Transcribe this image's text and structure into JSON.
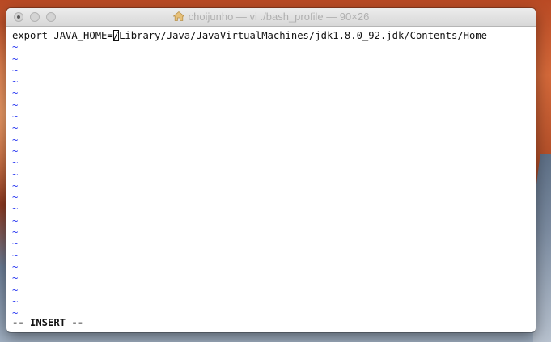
{
  "window": {
    "title": "choijunho — vi ./bash_profile — 90×26",
    "title_icon": "home-folder-icon"
  },
  "editor": {
    "line1_before_cursor": "export JAVA_HOME=",
    "cursor_char": "/",
    "line1_after_cursor": "Library/Java/JavaVirtualMachines/jdk1.8.0_92.jdk/Contents/Home",
    "empty_line_marker": "~",
    "empty_line_count": 24,
    "empty_line_color": "#2c3bf2"
  },
  "status": {
    "mode": "-- INSERT --"
  },
  "colors": {
    "wallpaper_top": "#b94a24",
    "title_text": "#b0b0b0"
  }
}
